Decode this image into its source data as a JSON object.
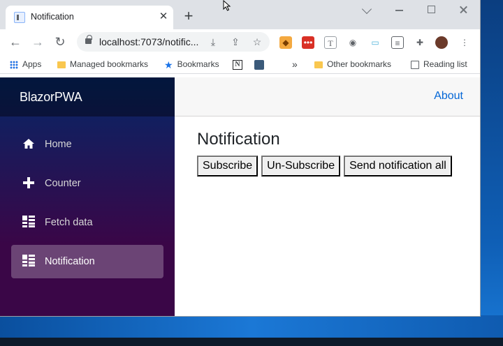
{
  "browser": {
    "tab_title": "Notification",
    "tab_close": "✕",
    "new_tab": "+",
    "url": "localhost:7073/notific...",
    "nav": {
      "back": "←",
      "forward": "→",
      "reload": "↻"
    }
  },
  "bookmarks": {
    "items": [
      {
        "label": "Apps"
      },
      {
        "label": "Managed bookmarks"
      },
      {
        "label": "Bookmarks"
      },
      {
        "label": "Other bookmarks"
      },
      {
        "label": "Reading list"
      }
    ],
    "overflow": "»"
  },
  "app": {
    "brand": "BlazorPWA",
    "about": "About",
    "nav": [
      {
        "label": "Home",
        "icon": "home-icon"
      },
      {
        "label": "Counter",
        "icon": "plus-icon"
      },
      {
        "label": "Fetch data",
        "icon": "list-icon"
      },
      {
        "label": "Notification",
        "icon": "list-icon",
        "active": true
      }
    ],
    "page_title": "Notification",
    "buttons": {
      "subscribe": "Subscribe",
      "unsubscribe": "Un-Subscribe",
      "send_all": "Send notification all"
    }
  },
  "colors": {
    "sidebar_top": "#052767",
    "sidebar_bottom": "#3a0647",
    "link": "#0366d6"
  }
}
